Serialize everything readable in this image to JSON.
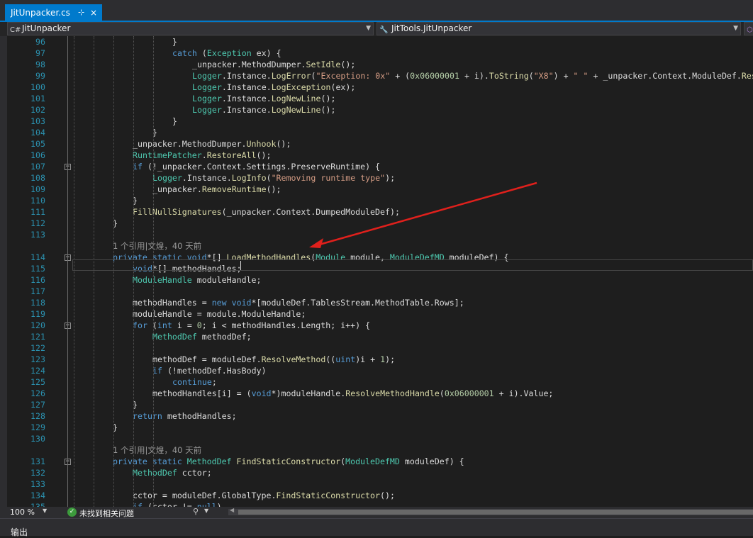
{
  "tab": {
    "title": "JitUnpacker.cs",
    "pin": "⊹",
    "close": "×"
  },
  "navbar": {
    "project_icon": "C#",
    "project": "JitUnpacker",
    "type_icon": "class-icon",
    "type": "JitTools.JitUnpacker",
    "member_icon": "method-icon"
  },
  "code_lenses": [
    {
      "before_line": 114,
      "text": "1 个引用|文煌，40 天前"
    },
    {
      "before_line": 131,
      "text": "1 个引用|文煌，40 天前"
    }
  ],
  "code_lines": [
    {
      "n": 96,
      "indent": 16,
      "html": "}"
    },
    {
      "n": 97,
      "indent": 16,
      "html": "<span class='k'>catch</span> (<span class='t'>Exception</span> ex) {"
    },
    {
      "n": 98,
      "indent": 20,
      "html": "_unpacker.MethodDumper.<span class='m'>SetIdle</span>();"
    },
    {
      "n": 99,
      "indent": 20,
      "html": "<span class='t'>Logger</span>.Instance.<span class='m'>LogError</span>(<span class='s'>\"Exception: 0x\"</span> + (<span class='n'>0x06000001</span> + i).<span class='m'>ToString</span>(<span class='s'>\"X8\"</span>) + <span class='s'>\" \"</span> + _unpacker.Context.ModuleDef.<span class='m'>ResolveMethod</span>"
    },
    {
      "n": 100,
      "indent": 20,
      "html": "<span class='t'>Logger</span>.Instance.<span class='m'>LogException</span>(ex);"
    },
    {
      "n": 101,
      "indent": 20,
      "html": "<span class='t'>Logger</span>.Instance.<span class='m'>LogNewLine</span>();"
    },
    {
      "n": 102,
      "indent": 20,
      "html": "<span class='t'>Logger</span>.Instance.<span class='m'>LogNewLine</span>();"
    },
    {
      "n": 103,
      "indent": 16,
      "html": "}"
    },
    {
      "n": 104,
      "indent": 12,
      "html": "}"
    },
    {
      "n": 105,
      "indent": 8,
      "html": "_unpacker.MethodDumper.<span class='m'>Unhook</span>();"
    },
    {
      "n": 106,
      "indent": 8,
      "html": "<span class='t'>RuntimePatcher</span>.<span class='m'>RestoreAll</span>();"
    },
    {
      "n": 107,
      "indent": 8,
      "html": "<span class='k'>if</span> (!_unpacker.Context.Settings.PreserveRuntime) {"
    },
    {
      "n": 108,
      "indent": 12,
      "html": "<span class='t'>Logger</span>.Instance.<span class='m'>LogInfo</span>(<span class='s'>\"Removing runtime type\"</span>);"
    },
    {
      "n": 109,
      "indent": 12,
      "html": "_unpacker.<span class='m'>RemoveRuntime</span>();"
    },
    {
      "n": 110,
      "indent": 8,
      "html": "}"
    },
    {
      "n": 111,
      "indent": 8,
      "html": "<span class='m'>FillNullSignatures</span>(_unpacker.Context.DumpedModuleDef);"
    },
    {
      "n": 112,
      "indent": 4,
      "html": "}"
    },
    {
      "n": 113,
      "indent": 0,
      "html": ""
    },
    {
      "n": 114,
      "indent": 4,
      "html": "<span class='k'>private static void</span>*[] <span class='m'>LoadMethodHandles</span>(<span class='t'>Module</span> module, <span class='t'>ModuleDefMD</span> moduleDef) {"
    },
    {
      "n": 115,
      "indent": 8,
      "html": "<span class='k'>void</span>*[] methodHandles;"
    },
    {
      "n": 116,
      "indent": 8,
      "html": "<span class='t'>ModuleHandle</span> moduleHandle;"
    },
    {
      "n": 117,
      "indent": 0,
      "html": ""
    },
    {
      "n": 118,
      "indent": 8,
      "html": "methodHandles = <span class='k'>new void</span>*[moduleDef.TablesStream.MethodTable.Rows];"
    },
    {
      "n": 119,
      "indent": 8,
      "html": "moduleHandle = module.ModuleHandle;"
    },
    {
      "n": 120,
      "indent": 8,
      "html": "<span class='k'>for</span> (<span class='k'>int</span> i = <span class='n'>0</span>; i &lt; methodHandles.Length; i++) {"
    },
    {
      "n": 121,
      "indent": 12,
      "html": "<span class='t'>MethodDef</span> methodDef;"
    },
    {
      "n": 122,
      "indent": 0,
      "html": ""
    },
    {
      "n": 123,
      "indent": 12,
      "html": "methodDef = moduleDef.<span class='m'>ResolveMethod</span>((<span class='k'>uint</span>)i + <span class='n'>1</span>);"
    },
    {
      "n": 124,
      "indent": 12,
      "html": "<span class='k'>if</span> (!methodDef.HasBody)"
    },
    {
      "n": 125,
      "indent": 16,
      "html": "<span class='k'>continue</span>;"
    },
    {
      "n": 126,
      "indent": 12,
      "html": "methodHandles[i] = (<span class='k'>void</span>*)moduleHandle.<span class='m'>ResolveMethodHandle</span>(<span class='n'>0x06000001</span> + i).Value;"
    },
    {
      "n": 127,
      "indent": 8,
      "html": "}"
    },
    {
      "n": 128,
      "indent": 8,
      "html": "<span class='k'>return</span> methodHandles;"
    },
    {
      "n": 129,
      "indent": 4,
      "html": "}"
    },
    {
      "n": 130,
      "indent": 0,
      "html": ""
    },
    {
      "n": 131,
      "indent": 4,
      "html": "<span class='k'>private static</span> <span class='t'>MethodDef</span> <span class='m'>FindStaticConstructor</span>(<span class='t'>ModuleDefMD</span> moduleDef) {"
    },
    {
      "n": 132,
      "indent": 8,
      "html": "<span class='t'>MethodDef</span> cctor;"
    },
    {
      "n": 133,
      "indent": 0,
      "html": ""
    },
    {
      "n": 134,
      "indent": 8,
      "html": "cctor = moduleDef.GlobalType.<span class='m'>FindStaticConstructor</span>();"
    },
    {
      "n": 135,
      "indent": 8,
      "html": "<span class='k'>if</span> (cctor != <span class='k'>null</span>)"
    }
  ],
  "fold_lines": [
    107,
    114,
    120,
    131
  ],
  "status": {
    "zoom": "100 %",
    "issues": "未找到相关问题",
    "ok_icon": "✓",
    "brush_icon": "⚲"
  },
  "bottom": {
    "output_label": "输出"
  },
  "annotation": {
    "color": "#e0201c"
  }
}
